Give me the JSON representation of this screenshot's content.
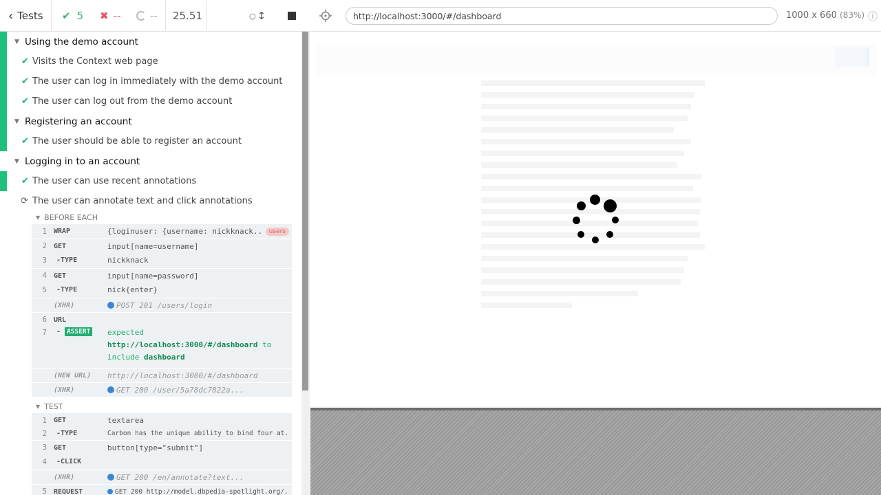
{
  "stats": {
    "back_label": "Tests",
    "passed": "5",
    "failed": "--",
    "pending": "--",
    "duration": "25.51"
  },
  "runnables": {
    "suites": [
      {
        "title": "Using the demo account",
        "tests": [
          {
            "title": "Visits the Context web page",
            "state": "passed"
          },
          {
            "title": "The user can log in immediately with the demo account",
            "state": "passed"
          },
          {
            "title": "The user can log out from the demo account",
            "state": "passed"
          }
        ]
      },
      {
        "title": "Registering an account",
        "tests": [
          {
            "title": "The user should be able to register an account",
            "state": "passed"
          }
        ]
      },
      {
        "title": "Logging in to an account",
        "tests": [
          {
            "title": "The user can use recent annotations",
            "state": "passed"
          },
          {
            "title": "The user can annotate text and click annotations",
            "state": "running"
          }
        ]
      }
    ],
    "before_each": {
      "title": "BEFORE EACH",
      "commands": [
        {
          "num": "1",
          "name": "WRAP",
          "msg": "{loginuser: {username: nickknack..",
          "alias": "users"
        },
        {
          "num": "2",
          "name": "GET",
          "msg": "input[name=username]"
        },
        {
          "num": "3",
          "name": "-TYPE",
          "msg": "nickknack"
        },
        {
          "num": "4",
          "name": "GET",
          "msg": "input[name=password]"
        },
        {
          "num": "5",
          "name": "-TYPE",
          "msg": "nick{enter}"
        },
        {
          "num": "",
          "name": "(XHR)",
          "msg": "POST 201 /users/login"
        },
        {
          "num": "6",
          "name": "URL",
          "msg": ""
        },
        {
          "num": "7",
          "name": "ASSERT",
          "msg_expected": "expected",
          "msg_url": "http://localhost:3000/#/dashboard",
          "msg_to": "to",
          "msg_include": "include",
          "msg_value": "dashboard"
        },
        {
          "num": "",
          "name": "(NEW URL)",
          "msg": "http://localhost:3000/#/dashboard"
        },
        {
          "num": "",
          "name": "(XHR)",
          "msg": "GET 200 /user/5a78dc7822a..."
        }
      ]
    },
    "test": {
      "title": "TEST",
      "commands": [
        {
          "num": "1",
          "name": "GET",
          "msg": "textarea"
        },
        {
          "num": "2",
          "name": "-TYPE",
          "msg": "Carbon has the unique ability to bind four at.."
        },
        {
          "num": "3",
          "name": "GET",
          "msg": "button[type=\"submit\"]"
        },
        {
          "num": "4",
          "name": "-CLICK",
          "msg": ""
        },
        {
          "num": "",
          "name": "(XHR)",
          "msg": "GET 200 /en/annotate?text..."
        },
        {
          "num": "5",
          "name": "REQUEST",
          "msg": "GET 200 http://model.dbpedia-spotlight.org/.."
        }
      ]
    }
  },
  "url_bar": {
    "url": "http://localhost:3000/#/dashboard",
    "viewport": "1000 x 660",
    "scale": "(83%)"
  },
  "colors": {
    "passed": "#1fc07d",
    "failed": "#e94f5f",
    "assert": "#1fae6e",
    "xhr_dot": "#3b86d3"
  },
  "icons": {
    "back": "chevron-left-icon",
    "passed": "check-icon",
    "failed": "x-icon",
    "pending": "circle-icon",
    "running": "refresh-icon",
    "selector": "crosshair-icon",
    "stop": "stop-icon",
    "info": "info-icon"
  }
}
